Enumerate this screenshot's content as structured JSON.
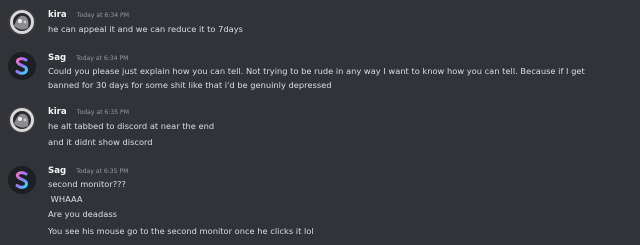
{
  "messages": [
    {
      "author": "kira",
      "timestamp": "Today at 6:34 PM",
      "avatar_icon": "kira-avatar-icon",
      "lines": [
        "he can appeal it and we can reduce it to 7days"
      ]
    },
    {
      "author": "Sag",
      "timestamp": "Today at 6:34 PM",
      "avatar_icon": "sag-avatar-icon",
      "lines": [
        "Could you please just explain how you can tell. Not trying to be rude in any way I want to know how you can tell. Because if I get",
        "banned for 30 days for some shit like that i'd be genuinly depressed"
      ]
    },
    {
      "author": "kira",
      "timestamp": "Today at 6:35 PM",
      "avatar_icon": "kira-avatar-icon",
      "lines": [
        "he alt tabbed to discord at near the end",
        "and it didnt show discord"
      ]
    },
    {
      "author": "Sag",
      "timestamp": "Today at 6:35 PM",
      "avatar_icon": "sag-avatar-icon",
      "lines": [
        "second monitor???",
        " WHAAA",
        "Are you deadass",
        "You see his mouse go to the second monitor once he clicks it lol"
      ]
    }
  ],
  "colors": {
    "background": "#313338",
    "username": "#f2f3f5",
    "timestamp": "#949ba4",
    "message_text": "#dbdee1",
    "sag_avatar_bg": "#1e1f22"
  }
}
